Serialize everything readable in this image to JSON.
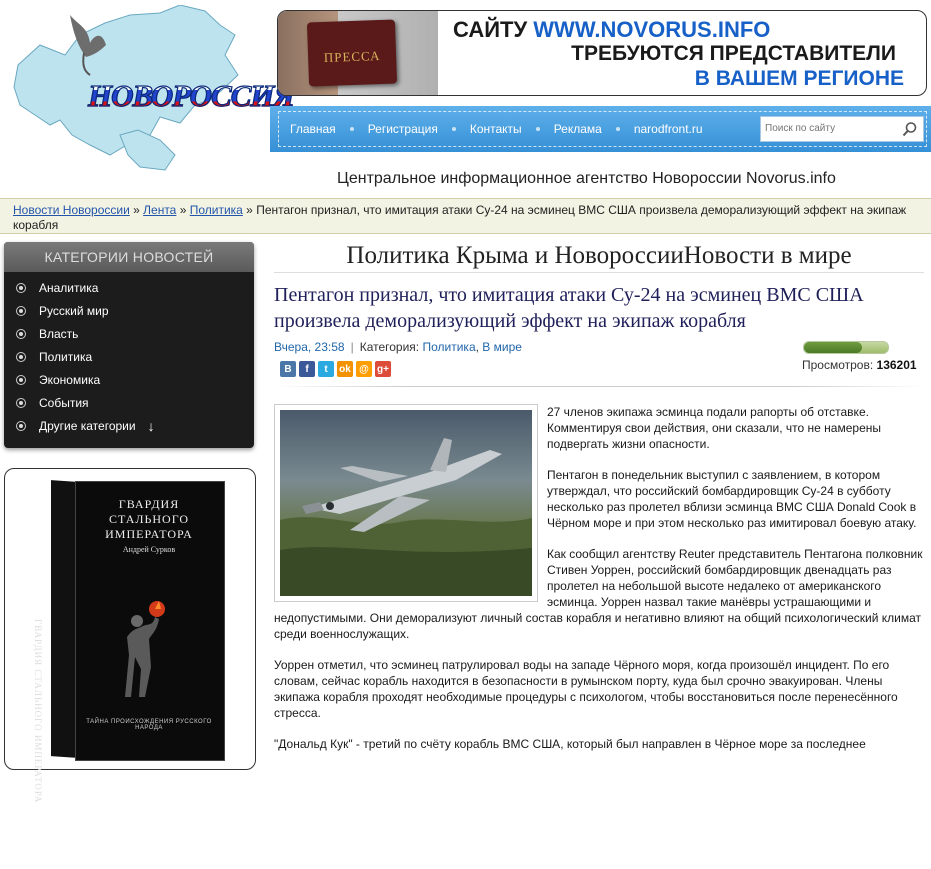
{
  "header": {
    "logo_text": "НОВОРОССИЯ",
    "banner": {
      "badge": "ПРЕССА",
      "line1_prefix": "САЙТУ",
      "line1_url": "WWW.NOVORUS.INFO",
      "line2": "ТРЕБУЮТСЯ ПРЕДСТАВИТЕЛИ",
      "line3": "В ВАШЕМ РЕГИОНЕ"
    },
    "nav": [
      "Главная",
      "Регистрация",
      "Контакты",
      "Реклама",
      "narodfront.ru"
    ],
    "search_placeholder": "Поиск по сайту",
    "tagline": "Центральное информационное агентство Новороссии Novorus.info"
  },
  "breadcrumb": {
    "items": [
      "Новости Новороссии",
      "Лента",
      "Политика"
    ],
    "current": "Пентагон признал, что имитация атаки Су-24 на эсминец ВМС США произвела деморализующий эффект на экипаж корабля"
  },
  "sidebar": {
    "heading": "КАТЕГОРИИ НОВОСТЕЙ",
    "items": [
      "Аналитика",
      "Русский мир",
      "Власть",
      "Политика",
      "Экономика",
      "События",
      "Другие категории"
    ],
    "book": {
      "title": "ГВАРДИЯ СТАЛЬНОГО ИМПЕРАТОРА",
      "author": "Андрей Сурков",
      "subtitle": "ТАЙНА ПРОИСХОЖДЕНИЯ РУССКОГО НАРОДА",
      "spine": "ГВАРДИЯ СТАЛЬНОГО ИМПЕРАТОРА"
    }
  },
  "article": {
    "section": "Политика Крыма и НовороссииНовости в мире",
    "title": "Пентагон признал, что имитация атаки Су-24 на эсминец ВМС США произвела деморализующий эффект на экипаж корабля",
    "time": "Вчера, 23:58",
    "category_label": "Категория:",
    "categories": [
      "Политика",
      "В мире"
    ],
    "views_label": "Просмотров:",
    "views": "136201",
    "share_icons": [
      "vk-icon",
      "facebook-icon",
      "twitter-icon",
      "odnoklassniki-icon",
      "mailru-icon",
      "googleplus-icon"
    ],
    "paragraphs": [
      "27 членов экипажа эсминца подали рапорты об отставке. Комментируя свои действия, они сказали, что не намерены подвергать жизни опасности.",
      "Пентагон в понедельник выступил с заявлением, в котором утверждал, что российский бомбардировщик Су-24 в субботу несколько раз пролетел вблизи эсминца ВМС США Donald Cook в Чёрном море и при этом несколько раз имитировал боевую атаку.",
      "Как сообщил агентству Reuter представитель Пентагона полковник Стивен Уоррен, российский бомбардировщик двенадцать раз пролетел на небольшой высоте недалеко от американского эсминца. Уоррен назвал такие манёвры устрашающими и недопустимыми. Они деморализуют личный состав корабля и негативно влияют на общий психологический климат среди военнослужащих.",
      "Уоррен отметил, что эсминец патрулировал воды на западе Чёрного моря, когда произошёл инцидент. По его словам, сейчас корабль находится в безопасности в румынском порту, куда был срочно эвакуирован. Члены экипажа корабля проходят необходимые процедуры с психологом, чтобы восстановиться после перенесённого стресса.",
      "\"Дональд Кук\" - третий по счёту корабль ВМС США, который был направлен в Чёрное море за последнее"
    ]
  },
  "colors": {
    "nav_blue": "#3690d6",
    "link_blue": "#2255aa",
    "title_navy": "#1f1f5a",
    "sidebar_bg": "#1c1c1c"
  }
}
